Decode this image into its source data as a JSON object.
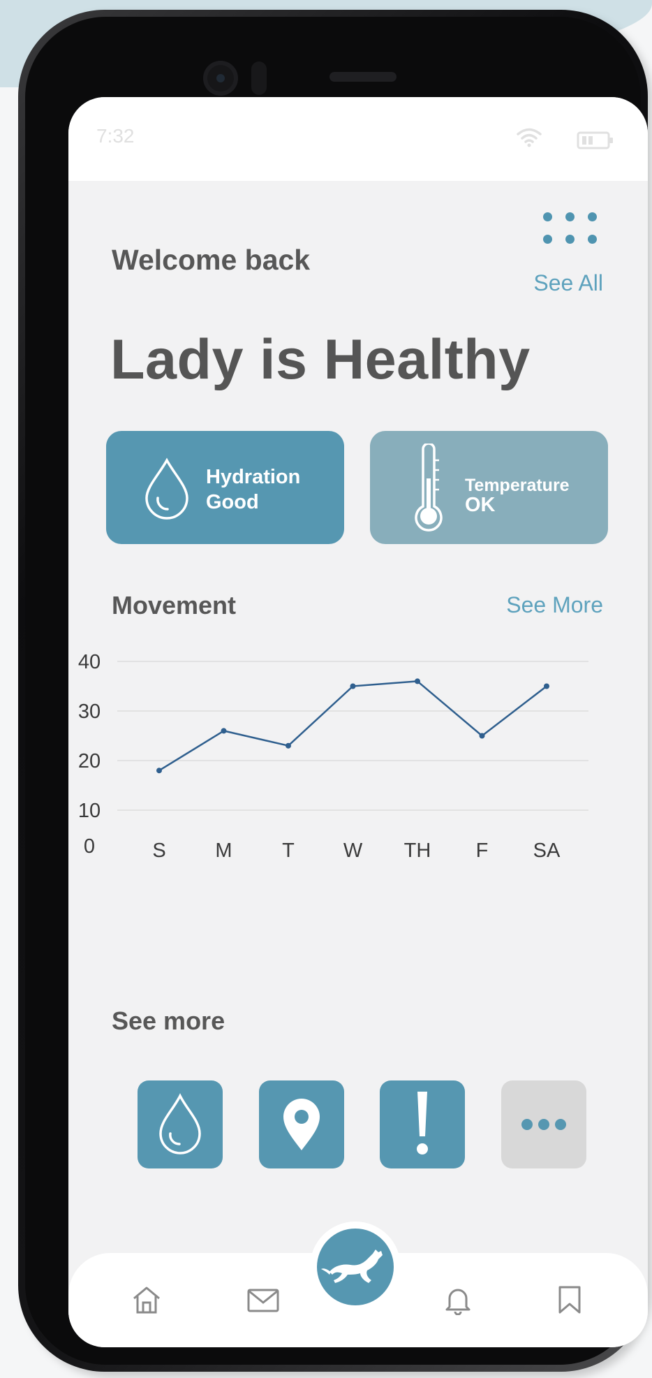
{
  "status_bar": {
    "time": "7:32"
  },
  "header": {
    "greeting": "Welcome back",
    "see_all_label": "See All",
    "headline": "Lady is Healthy"
  },
  "cards": {
    "hydration": {
      "title": "Hydration",
      "value": "Good"
    },
    "temperature": {
      "title": "Temperature",
      "value": "OK"
    }
  },
  "movement": {
    "title": "Movement",
    "see_more_label": "See More"
  },
  "chart_data": {
    "type": "line",
    "categories": [
      "S",
      "M",
      "T",
      "W",
      "TH",
      "F",
      "SA"
    ],
    "values": [
      18,
      26,
      23,
      35,
      36,
      25,
      35
    ],
    "y_ticks": [
      40,
      30,
      20,
      10,
      0
    ],
    "ylim": [
      0,
      40
    ],
    "grid": true,
    "line_color": "#2f5f8e"
  },
  "see_more": {
    "title": "See more",
    "tiles": [
      {
        "icon": "water-drop-icon"
      },
      {
        "icon": "location-pin-icon"
      },
      {
        "icon": "alert-icon"
      },
      {
        "icon": "more-icon"
      }
    ]
  },
  "bottom_nav": {
    "items": [
      "home-icon",
      "mail-icon",
      "horse-icon",
      "bell-icon",
      "bookmark-icon"
    ]
  },
  "colors": {
    "accent": "#5697b1",
    "accent_muted": "#88aebb",
    "link": "#5ea2bd",
    "text": "#575757"
  }
}
